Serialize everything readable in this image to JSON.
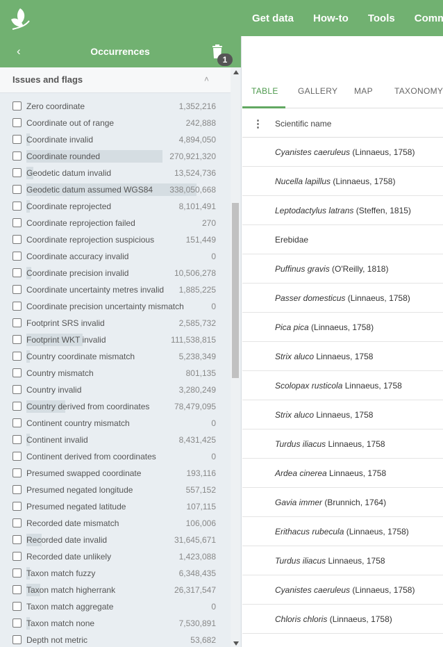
{
  "nav": {
    "items": [
      "Get data",
      "How-to",
      "Tools",
      "Community"
    ]
  },
  "drawer": {
    "title": "Occurrences",
    "badge": "1",
    "section_title": "Issues and flags"
  },
  "flags": [
    {
      "label": "Zero coordinate",
      "count": "1,352,216",
      "fraction": 0.0
    },
    {
      "label": "Coordinate out of range",
      "count": "242,888",
      "fraction": 0.0
    },
    {
      "label": "Coordinate invalid",
      "count": "4,894,050",
      "fraction": 0.02
    },
    {
      "label": "Coordinate rounded",
      "count": "270,921,320",
      "fraction": 0.8
    },
    {
      "label": "Geodetic datum invalid",
      "count": "13,524,736",
      "fraction": 0.04
    },
    {
      "label": "Geodetic datum assumed WGS84",
      "count": "338,050,668",
      "fraction": 1.0
    },
    {
      "label": "Coordinate reprojected",
      "count": "8,101,491",
      "fraction": 0.02
    },
    {
      "label": "Coordinate reprojection failed",
      "count": "270",
      "fraction": 0.0
    },
    {
      "label": "Coordinate reprojection suspicious",
      "count": "151,449",
      "fraction": 0.0
    },
    {
      "label": "Coordinate accuracy invalid",
      "count": "0",
      "fraction": 0.0
    },
    {
      "label": "Coordinate precision invalid",
      "count": "10,506,278",
      "fraction": 0.03
    },
    {
      "label": "Coordinate uncertainty metres invalid",
      "count": "1,885,225",
      "fraction": 0.0
    },
    {
      "label": "Coordinate precision uncertainty mismatch",
      "count": "0",
      "fraction": 0.0
    },
    {
      "label": "Footprint SRS invalid",
      "count": "2,585,732",
      "fraction": 0.0
    },
    {
      "label": "Footprint WKT invalid",
      "count": "111,538,815",
      "fraction": 0.33
    },
    {
      "label": "Country coordinate mismatch",
      "count": "5,238,349",
      "fraction": 0.02
    },
    {
      "label": "Country mismatch",
      "count": "801,135",
      "fraction": 0.0
    },
    {
      "label": "Country invalid",
      "count": "3,280,249",
      "fraction": 0.0
    },
    {
      "label": "Country derived from coordinates",
      "count": "78,479,095",
      "fraction": 0.23
    },
    {
      "label": "Continent country mismatch",
      "count": "0",
      "fraction": 0.0
    },
    {
      "label": "Continent invalid",
      "count": "8,431,425",
      "fraction": 0.02
    },
    {
      "label": "Continent derived from coordinates",
      "count": "0",
      "fraction": 0.0
    },
    {
      "label": "Presumed swapped coordinate",
      "count": "193,116",
      "fraction": 0.0
    },
    {
      "label": "Presumed negated longitude",
      "count": "557,152",
      "fraction": 0.0
    },
    {
      "label": "Presumed negated latitude",
      "count": "107,115",
      "fraction": 0.0
    },
    {
      "label": "Recorded date mismatch",
      "count": "106,006",
      "fraction": 0.0
    },
    {
      "label": "Recorded date invalid",
      "count": "31,645,671",
      "fraction": 0.09
    },
    {
      "label": "Recorded date unlikely",
      "count": "1,423,088",
      "fraction": 0.0
    },
    {
      "label": "Taxon match fuzzy",
      "count": "6,348,435",
      "fraction": 0.02
    },
    {
      "label": "Taxon match higherrank",
      "count": "26,317,547",
      "fraction": 0.08
    },
    {
      "label": "Taxon match aggregate",
      "count": "0",
      "fraction": 0.0
    },
    {
      "label": "Taxon match none",
      "count": "7,530,891",
      "fraction": 0.02
    },
    {
      "label": "Depth not metric",
      "count": "53,682",
      "fraction": 0.0
    }
  ],
  "tabs": [
    "TABLE",
    "GALLERY",
    "MAP",
    "TAXONOMY"
  ],
  "active_tab": "TABLE",
  "table": {
    "column": "Scientific name",
    "rows": [
      {
        "name": "Cyanistes caeruleus",
        "author": " (Linnaeus, 1758)"
      },
      {
        "name": "Nucella lapillus",
        "author": " (Linnaeus, 1758)"
      },
      {
        "name": "Leptodactylus latrans",
        "author": " (Steffen, 1815)"
      },
      {
        "name": "",
        "author": "Erebidae"
      },
      {
        "name": "Puffinus gravis",
        "author": " (O'Reilly, 1818)"
      },
      {
        "name": "Passer domesticus",
        "author": " (Linnaeus, 1758)"
      },
      {
        "name": "Pica pica",
        "author": " (Linnaeus, 1758)"
      },
      {
        "name": "Strix aluco",
        "author": " Linnaeus, 1758"
      },
      {
        "name": "Scolopax rusticola",
        "author": " Linnaeus, 1758"
      },
      {
        "name": "Strix aluco",
        "author": " Linnaeus, 1758"
      },
      {
        "name": "Turdus iliacus",
        "author": " Linnaeus, 1758"
      },
      {
        "name": "Ardea cinerea",
        "author": " Linnaeus, 1758"
      },
      {
        "name": "Gavia immer",
        "author": " (Brunnich, 1764)"
      },
      {
        "name": "Erithacus rubecula",
        "author": " (Linnaeus, 1758)"
      },
      {
        "name": "Turdus iliacus",
        "author": " Linnaeus, 1758"
      },
      {
        "name": "Cyanistes caeruleus",
        "author": " (Linnaeus, 1758)"
      },
      {
        "name": "Chloris chloris",
        "author": " (Linnaeus, 1758)"
      }
    ]
  },
  "colors": {
    "brand": "#71b171",
    "accent": "#61a861"
  }
}
